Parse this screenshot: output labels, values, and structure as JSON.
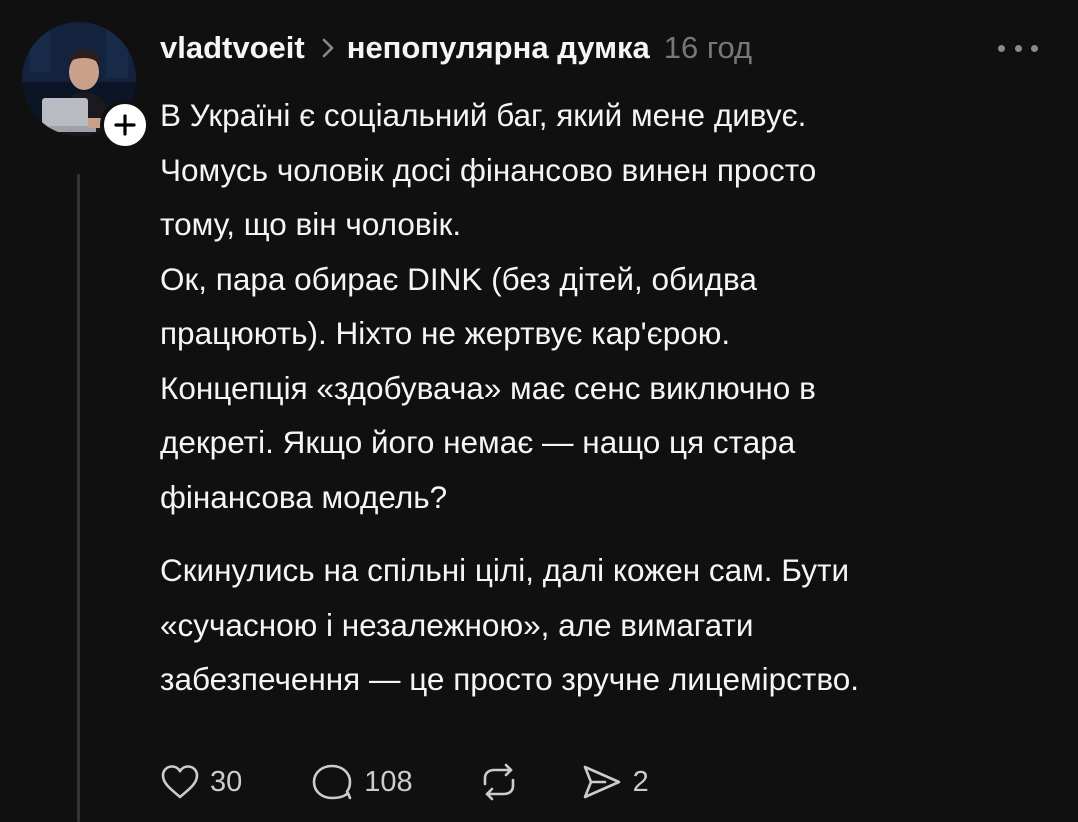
{
  "post": {
    "username": "vladtvoeit",
    "community": "непопулярна думка",
    "timestamp": "16 год",
    "paragraph1_lines": [
      "В Україні є соціальний баг, який мене дивує.",
      "Чомусь чоловік досі фінансово винен просто",
      "тому, що він чоловік.",
      "Ок, пара обирає DINK (без дітей, обидва",
      "працюють). Ніхто не жертвує кар'єрою.",
      "Концепція «здобувача» має сенс виключно в",
      "декреті. Якщо його немає — нащо ця стара",
      "фінансова модель?"
    ],
    "paragraph2_lines": [
      "Скинулись на спільні цілі, далі кожен сам. Бути",
      "«сучасною і незалежною», але вимагати",
      "забезпечення — це просто зручне лицемірство."
    ],
    "actions": {
      "likes": "30",
      "replies": "108",
      "shares": "2"
    }
  },
  "icons": {
    "follow": "plus-icon",
    "more": "more-horizontal-icon",
    "separator": "chevron-right-icon",
    "like": "heart-icon",
    "reply": "comment-icon",
    "repost": "repost-icon",
    "share": "send-icon"
  },
  "colors": {
    "background": "#101010",
    "text": "#f3f5f7",
    "muted": "#777777",
    "thread_line": "#333638"
  }
}
